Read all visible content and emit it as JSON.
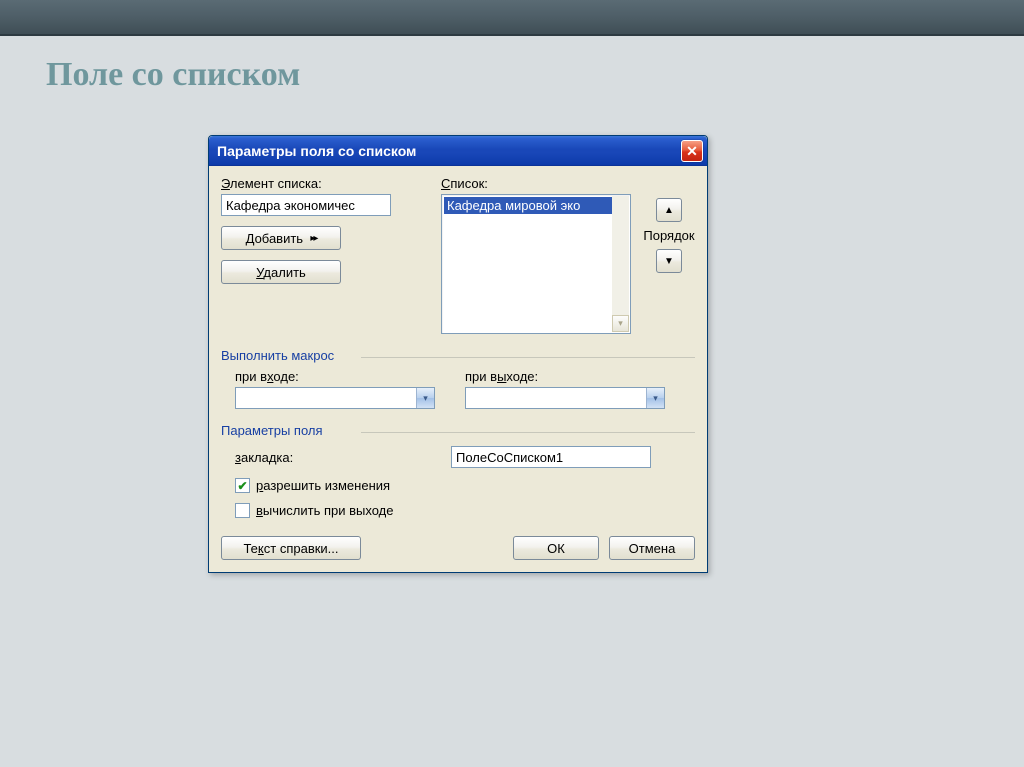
{
  "page": {
    "title": "Поле со списком"
  },
  "dialog": {
    "title": "Параметры поля со списком",
    "close": "X"
  },
  "labels": {
    "element": "Элемент списка:",
    "list": "Список:",
    "order": "Порядок",
    "macro_group": "Выполнить макрос",
    "on_enter": "при входе:",
    "on_exit": "при выходе:",
    "field_params": "Параметры поля",
    "bookmark": "закладка:",
    "allow_changes": "разрешить изменения",
    "calc_on_exit": "вычислить при выходе"
  },
  "values": {
    "element_input": "Кафедра экономичес",
    "list_item": "Кафедра мировой эко",
    "bookmark": "ПолеСоСписком1",
    "on_enter": "",
    "on_exit": "",
    "allow_changes_checked": true,
    "calc_on_exit_checked": false
  },
  "buttons": {
    "add": "Добавить",
    "delete": "Удалить",
    "help": "Текст справки...",
    "ok": "ОК",
    "cancel": "Отмена",
    "arrow_up": "▲",
    "arrow_down": "▼",
    "add_arrows": "▸▸"
  }
}
